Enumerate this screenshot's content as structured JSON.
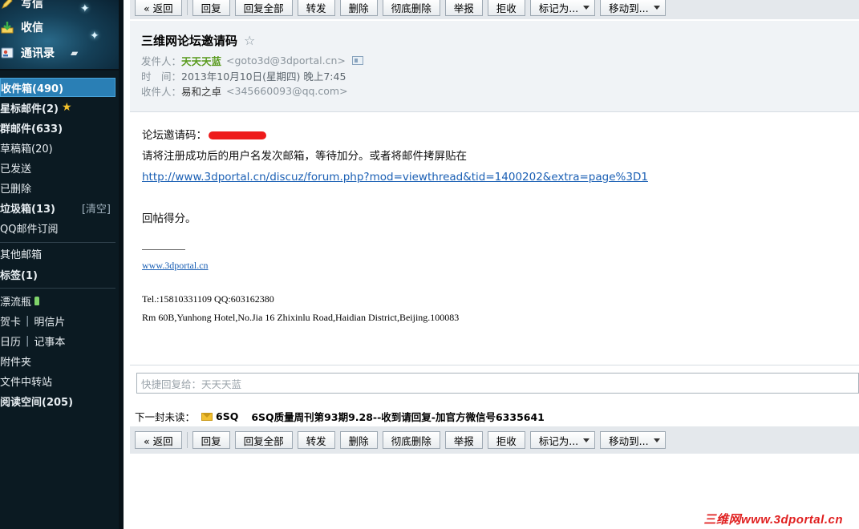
{
  "sidebar": {
    "top_items": [
      {
        "label": "写信",
        "icon": "pencil-icon"
      },
      {
        "label": "收信",
        "icon": "inbox-download-icon"
      },
      {
        "label": "通讯录",
        "icon": "address-book-icon"
      }
    ],
    "folders": [
      {
        "label": "收件箱(490)"
      },
      {
        "label": "星标邮件(2)"
      },
      {
        "label": "群邮件(633)"
      },
      {
        "label": "草稿箱(20)"
      },
      {
        "label": "已发送"
      },
      {
        "label": "已删除"
      },
      {
        "label": "垃圾箱(13)",
        "extra": "[清空]"
      },
      {
        "label": "QQ邮件订阅"
      },
      {
        "label": "其他邮箱"
      },
      {
        "label": "标签(1)"
      },
      {
        "label": "漂流瓶"
      },
      {
        "label": "贺卡",
        "label2": "明信片"
      },
      {
        "label": "日历",
        "label2": "记事本"
      },
      {
        "label": "附件夹"
      },
      {
        "label": "文件中转站"
      },
      {
        "label": "阅读空间(205)"
      }
    ]
  },
  "toolbar": {
    "back": "« 返回",
    "reply": "回复",
    "reply_all": "回复全部",
    "forward": "转发",
    "delete": "删除",
    "delete_permanent": "彻底删除",
    "report": "举报",
    "reject": "拒收",
    "mark_as": "标记为...",
    "move_to": "移动到..."
  },
  "email": {
    "subject": "三维网论坛邀请码",
    "sender_label": "发件人：",
    "sender_name": "天天天蓝",
    "sender_addr": "<goto3d@3dportal.cn>",
    "time_label": "时　间：",
    "time_value": "2013年10月10日(星期四) 晚上7:45",
    "recipient_label": "收件人：",
    "recipient_name": "易和之卓",
    "recipient_addr": "<345660093@qq.com>",
    "body": {
      "code_label": "论坛邀请码：",
      "line2": "请将注册成功后的用户名发次邮箱，等待加分。或者将邮件拷屏贴在",
      "url": "http://www.3dportal.cn/discuz/forum.php?mod=viewthread&tid=1400202&extra=page%3D1",
      "line4": "回帖得分。"
    },
    "signature": {
      "site": "www.3dportal.cn",
      "contact": "Tel.:15810331109  QQ:603162380",
      "address": "Rm 60B,Yunhong Hotel,No.Jia 16 Zhixinlu Road,Haidian District,Beijing.100083"
    }
  },
  "reply_box": {
    "placeholder": "快捷回复给：天天天蓝"
  },
  "next_unread": {
    "label": "下一封未读：",
    "from": "6SQ",
    "subject": "6SQ质量周刊第93期9.28--收到请回复-加官方微信号6335641"
  },
  "watermark": "三维网www.3dportal.cn",
  "colors": {
    "sidebar_bg": "#0b1a22",
    "active_folder": "#2a7fb5",
    "sender_green": "#5a9b1f",
    "link_blue": "#1a5fb4",
    "redaction_red": "#ee1b1b"
  }
}
